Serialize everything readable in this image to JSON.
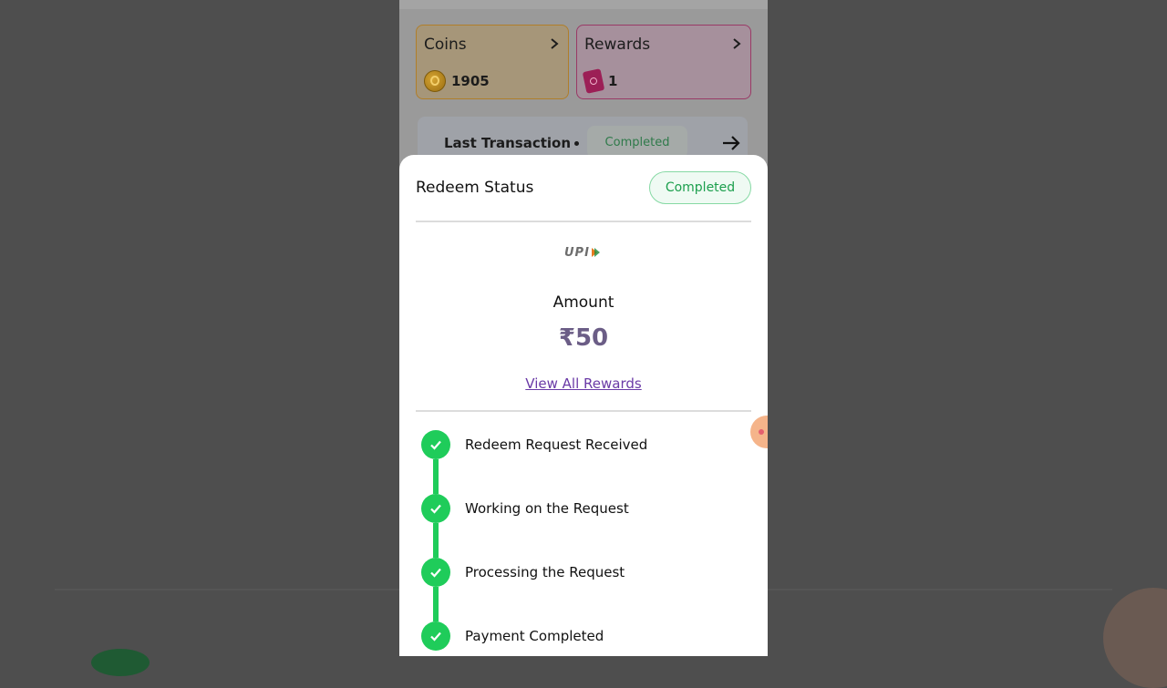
{
  "background_page": {
    "coins_card": {
      "title": "Coins",
      "value": "1905",
      "icon": "coin-icon"
    },
    "rewards_card": {
      "title": "Rewards",
      "value": "1",
      "icon": "ticket-icon"
    },
    "last_transaction": {
      "label": "Last Transaction",
      "status": "Completed",
      "icon": "arrow-right-icon"
    }
  },
  "redeem_sheet": {
    "title": "Redeem Status",
    "status_badge": "Completed",
    "payment_method": "UPI",
    "amount_label": "Amount",
    "amount_value": "₹50",
    "view_rewards_link": "View All Rewards",
    "steps": [
      {
        "label": "Redeem Request Received",
        "done": true
      },
      {
        "label": "Working on the Request",
        "done": true
      },
      {
        "label": "Processing the Request",
        "done": true
      },
      {
        "label": "Payment Completed",
        "done": true
      }
    ]
  },
  "colors": {
    "success_green": "#1fcc5a",
    "amount_purple": "#6b5d86",
    "link_purple": "#6a3aa6"
  }
}
